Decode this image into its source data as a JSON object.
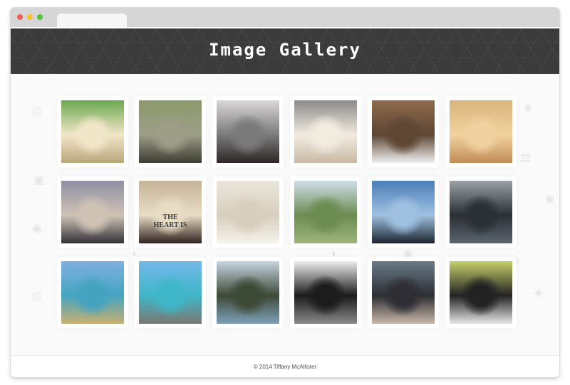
{
  "window": {
    "chrome_dots": [
      "close",
      "minimize",
      "maximize"
    ],
    "colors": {
      "close": "#f25f58",
      "minimize": "#fbbe2e",
      "maximize": "#56c23c"
    }
  },
  "header": {
    "title": "Image Gallery",
    "background_color": "#3b3b3b"
  },
  "gallery": {
    "photos": [
      {
        "alt": "chihuahua on grass",
        "palette": [
          "#6aa84f",
          "#f2e6c9",
          "#b9a67a"
        ]
      },
      {
        "alt": "boston terrier lying in grass",
        "palette": [
          "#8c9a6a",
          "#9d9d88",
          "#3d3d33"
        ]
      },
      {
        "alt": "car side mirror",
        "palette": [
          "#d9d6d6",
          "#7a7a7a",
          "#2e2626"
        ]
      },
      {
        "alt": "chihuahua face close-up",
        "palette": [
          "#8c8a8a",
          "#f1ebe0",
          "#c9b9a6"
        ]
      },
      {
        "alt": "boston terrier on wooden deck",
        "palette": [
          "#8e6a4c",
          "#5d4634",
          "#f0f0f0"
        ]
      },
      {
        "alt": "sleeping chihuahuas",
        "palette": [
          "#d8b47a",
          "#f0d2a0",
          "#c28c55"
        ]
      },
      {
        "alt": "boston terrier in water",
        "palette": [
          "#8f8fa3",
          "#cfc2b5",
          "#34323a"
        ]
      },
      {
        "alt": "chihuahua on heart pillow",
        "palette": [
          "#c5b497",
          "#e8dcc5",
          "#312420"
        ],
        "caption": "THE\nHEART IS"
      },
      {
        "alt": "chihuahua peeking",
        "palette": [
          "#eae6dc",
          "#d7cebd",
          "#f6f3ec"
        ]
      },
      {
        "alt": "green hills landscape",
        "palette": [
          "#cfdde8",
          "#6c8c52",
          "#9db57a"
        ]
      },
      {
        "alt": "sunset over lake",
        "palette": [
          "#4a7fb8",
          "#9fc0e0",
          "#1c2530"
        ]
      },
      {
        "alt": "fjord with mountains",
        "palette": [
          "#9aa0a6",
          "#2b3035",
          "#5b656e"
        ]
      },
      {
        "alt": "turquoise lake and mountain",
        "palette": [
          "#7fb0e0",
          "#44a4c0",
          "#c8b070"
        ]
      },
      {
        "alt": "turquoise shore with rocks",
        "palette": [
          "#74b8e8",
          "#3fb6c8",
          "#7a7872"
        ]
      },
      {
        "alt": "lake through trees",
        "palette": [
          "#c8d4e0",
          "#3d4a38",
          "#7fa0b8"
        ]
      },
      {
        "alt": "boston terrier black and white",
        "palette": [
          "#ededed",
          "#1c1c1c",
          "#8a8a8a"
        ]
      },
      {
        "alt": "woman holding puppy",
        "palette": [
          "#6a7a88",
          "#2e2e34",
          "#c8b8a8"
        ]
      },
      {
        "alt": "shih tzu on blanket",
        "palette": [
          "#c6d06a",
          "#232323",
          "#e6e6e6"
        ]
      }
    ]
  },
  "footer": {
    "copyright": "© 2014 Tiffany McAllister"
  }
}
